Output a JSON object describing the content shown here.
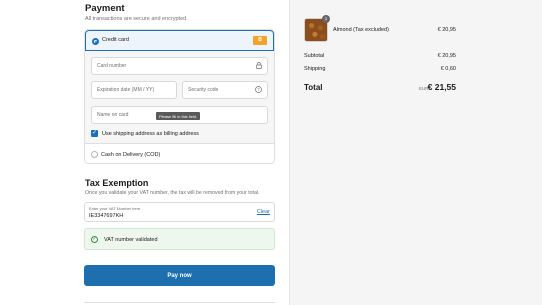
{
  "payment": {
    "title": "Payment",
    "subtitle": "All transactions are secure and encrypted.",
    "credit_card_label": "Credit card",
    "card_number_placeholder": "Card number",
    "expiration_placeholder": "Expiration date (MM / YY)",
    "security_placeholder": "Security code",
    "name_placeholder": "Name on card",
    "tooltip": "Please fill in this field.",
    "billing_checkbox_label": "Use shipping address as billing address",
    "cod_label": "Cash on Delivery (COD)"
  },
  "tax": {
    "title": "Tax Exemption",
    "subtitle": "Once you validate your VAT number, the tax will be removed from your total.",
    "vat_field_label": "Enter your VAT Number here",
    "vat_value": "IE3347697KH",
    "clear_label": "Clear",
    "validated_text": "VAT number validated"
  },
  "pay_button_label": "Pay now",
  "summary": {
    "product_qty": "1",
    "product_name": "Almond (Tax excluded)",
    "product_price": "€ 20,95",
    "subtotal_label": "Subtotal",
    "subtotal_value": "€ 20,95",
    "shipping_label": "Shipping",
    "shipping_value": "€ 0,60",
    "total_label": "Total",
    "total_currency": "EUR",
    "total_value": "€ 21,55"
  },
  "colors": {
    "accent": "#1e6fb5",
    "pay_button": "#1d6fb0",
    "validated_bg": "#edf7ee",
    "summary_bg": "#f5f5f5"
  },
  "icons": {
    "card_brand": "card-brand-icon",
    "lock": "lock-icon",
    "help": "help-icon",
    "check": "check-icon"
  }
}
